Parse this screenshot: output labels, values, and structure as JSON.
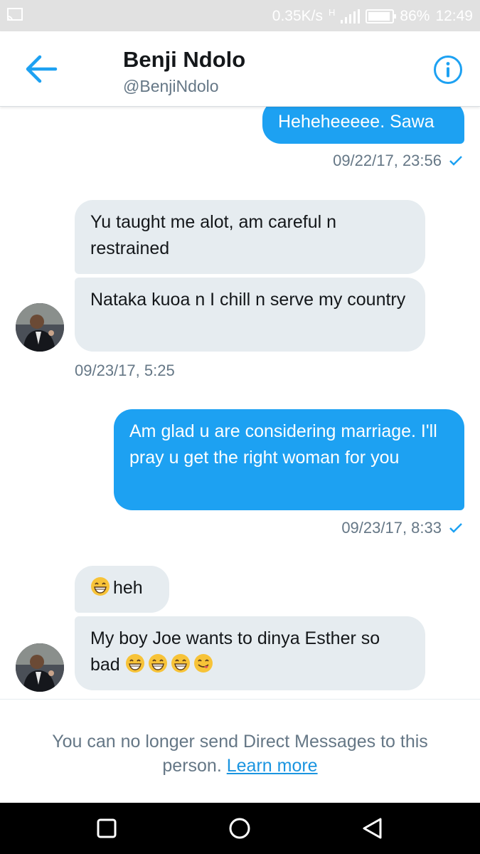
{
  "status_bar": {
    "network_speed": "0.35K/s",
    "network_type": "H",
    "battery": "86%",
    "time": "12:49",
    "icons": [
      "screen-cast-icon",
      "signal-icon",
      "battery-icon"
    ]
  },
  "header": {
    "title": "Benji Ndolo",
    "handle": "@BenjiNdolo",
    "back_icon": "back-arrow-icon",
    "info_icon": "info-icon",
    "accent_color": "#1da1f2"
  },
  "conversation": {
    "messages": [
      {
        "direction": "outgoing",
        "text": "Heheheeeee. Sawa"
      },
      {
        "direction": "incoming",
        "text": "Yu taught me alot, am careful n restrained"
      },
      {
        "direction": "incoming",
        "text": "Nataka kuoa n I chill n serve my country"
      },
      {
        "direction": "outgoing",
        "text": "Am glad u are considering marriage. I'll pray u get the right woman for you"
      },
      {
        "direction": "incoming",
        "text": "heh",
        "emojis": [
          "grinning-face"
        ]
      },
      {
        "direction": "incoming",
        "text": "My boy Joe wants to dinya Esther so bad",
        "emojis": [
          "grinning-face",
          "grinning-face",
          "grinning-face",
          "yum-face"
        ]
      }
    ],
    "timestamps": [
      "09/22/17, 23:56",
      "09/23/17, 5:25",
      "09/23/17, 8:33"
    ]
  },
  "footer": {
    "notice": "You can no longer send Direct Messages to this person.",
    "link": "Learn more"
  },
  "nav_bar": {
    "buttons": [
      "recent-apps-icon",
      "home-icon",
      "back-icon"
    ]
  },
  "colors": {
    "outgoing_bubble": "#1da1f2",
    "incoming_bubble": "#e6ecf0",
    "secondary_text": "#657786",
    "link": "#1b95e0"
  }
}
